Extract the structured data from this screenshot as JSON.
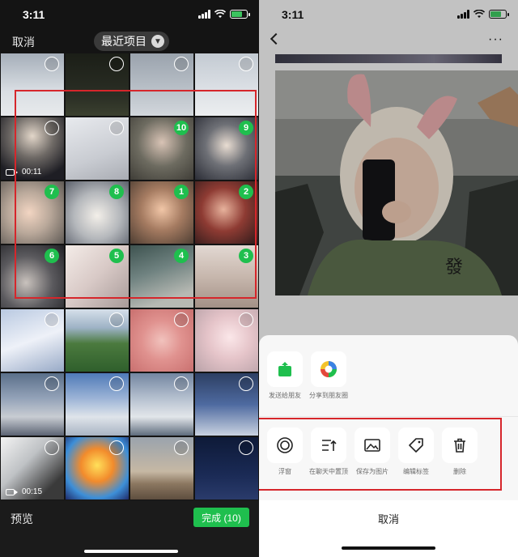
{
  "left_panel": {
    "status": {
      "time": "3:11"
    },
    "header": {
      "cancel_label": "取消",
      "album_label": "最近项目"
    },
    "cells": [
      {
        "sel": "",
        "video": "",
        "bg": "linear-gradient(180deg,#a5aeb9,#d9dee3 60%,#e8eaec)"
      },
      {
        "sel": "",
        "video": "",
        "bg": "linear-gradient(180deg,#1b1e17,#2b2f25 70%,#3b402f)"
      },
      {
        "sel": "",
        "video": "",
        "bg": "linear-gradient(180deg,#9aa3ad,#b5bcc4 50%,#d2d7dc)"
      },
      {
        "sel": "",
        "video": "",
        "bg": "linear-gradient(180deg,#c3cad2,#dde1e6 60%,#eceef0)"
      },
      {
        "sel": "",
        "video": "00:11",
        "bg": "radial-gradient(circle at 50% 30%,#e2d6c9,#6f6a66 40%,#1e1e24 80%)"
      },
      {
        "sel": "",
        "video": "",
        "bg": "linear-gradient(160deg,#e8eaee,#c9ccd2 60%,#a9acb3)"
      },
      {
        "sel": "10",
        "video": "",
        "bg": "radial-gradient(circle at 50% 40%,#d8c3b5,#6d6b60 50%,#3f3d37)"
      },
      {
        "sel": "9",
        "video": "",
        "bg": "radial-gradient(circle at 50% 45%,#e9ddd2,#6e7076 45%,#2b2d36)"
      },
      {
        "sel": "7",
        "video": "",
        "bg": "radial-gradient(circle at 45% 50%,#f2d5c2,#b9a89a 45%,#5f5a55)"
      },
      {
        "sel": "8",
        "video": "",
        "bg": "radial-gradient(circle at 50% 55%,#f3efe9,#b4b7bb 50%,#5b606b)"
      },
      {
        "sel": "1",
        "video": "",
        "bg": "radial-gradient(circle at 50% 45%,#f1c6a7,#a57b61 45%,#4e3e33)"
      },
      {
        "sel": "2",
        "video": "",
        "bg": "radial-gradient(circle at 45% 45%,#e7b29c,#8e3b33 45%,#2c1a1a)"
      },
      {
        "sel": "6",
        "video": "",
        "bg": "radial-gradient(circle at 40% 60%,#c9c2bd,#5b5a5e 50%,#222226)"
      },
      {
        "sel": "5",
        "video": "",
        "bg": "linear-gradient(135deg,#f4ece8,#d8c9c6 50%,#a79a98)"
      },
      {
        "sel": "4",
        "video": "",
        "bg": "linear-gradient(160deg,#3e5350,#6f8280 40%,#b7b9b3 80%)"
      },
      {
        "sel": "3",
        "video": "",
        "bg": "linear-gradient(180deg,#e2d8d2,#c7b7ad 50%,#a39187)"
      },
      {
        "sel": "",
        "video": "",
        "bg": "linear-gradient(160deg,#b9c9e1,#eef1f8 50%,#98aac7)"
      },
      {
        "sel": "",
        "video": "",
        "bg": "linear-gradient(180deg,#d6e0ea 0%,#9db2c5 30%,#4b7a3e 55%,#2f5f2c 100%)"
      },
      {
        "sel": "",
        "video": "",
        "bg": "radial-gradient(circle at 50% 50%,#f1c2bd,#e0928f 45%,#c9706f)"
      },
      {
        "sel": "",
        "video": "",
        "bg": "radial-gradient(circle at 55% 45%,#fbe7e9,#e5c4c9 45%,#b9a2a8)"
      },
      {
        "sel": "",
        "video": "",
        "bg": "linear-gradient(180deg,#5a6f8a,#93a2b8 40%,#c8ccd2 70%,#5c6474)"
      },
      {
        "sel": "",
        "video": "",
        "bg": "linear-gradient(180deg,#4f7ab8,#9bb3d6 40%,#dfe4ea 70%,#a9b5c4)"
      },
      {
        "sel": "",
        "video": "",
        "bg": "linear-gradient(180deg,#7386a1,#b5c0cf 40%,#e2e6ea 70%,#5e6c7d)"
      },
      {
        "sel": "",
        "video": "",
        "bg": "linear-gradient(180deg,#2d3f63,#4e6aa0 50%,#c9d2e0)"
      },
      {
        "sel": "",
        "video": "00:15",
        "bg": "linear-gradient(135deg,#f3f3f3,#bfc2c5 40%,#3a3a3a 80%)"
      },
      {
        "sel": "",
        "video": "",
        "bg": "radial-gradient(circle at 50% 45%,#ffe05a,#f28b2c 35%,#3d8fd8 70%,#1f2b6a)"
      },
      {
        "sel": "",
        "video": "",
        "bg": "linear-gradient(180deg,#9aa3ad,#c6b8a4 55%,#8b7760 75%,#5e4e3f)"
      },
      {
        "sel": "",
        "video": "",
        "bg": "linear-gradient(180deg,#0e1a38,#1a2a55 60%,#2a3b6b)"
      }
    ],
    "footer": {
      "preview_label": "预览",
      "done_label": "完成 (10)"
    }
  },
  "right_panel": {
    "status": {
      "time": "3:11"
    },
    "nav": {
      "more_label": "···"
    },
    "sheet": {
      "row1": [
        {
          "icon": "share-up-icon",
          "label": "发送给朋友"
        },
        {
          "icon": "moments-icon",
          "label": "分享到朋友圈"
        }
      ],
      "row2": [
        {
          "icon": "float-window-icon",
          "label": "浮窗"
        },
        {
          "icon": "pin-top-icon",
          "label": "在聊天中置顶"
        },
        {
          "icon": "image-save-icon",
          "label": "保存为图片"
        },
        {
          "icon": "tag-icon",
          "label": "编辑标签"
        },
        {
          "icon": "trash-icon",
          "label": "删除"
        }
      ],
      "cancel_label": "取消"
    }
  },
  "colors": {
    "accent_green": "#1fbf4e",
    "highlight_red": "#d6262b"
  }
}
